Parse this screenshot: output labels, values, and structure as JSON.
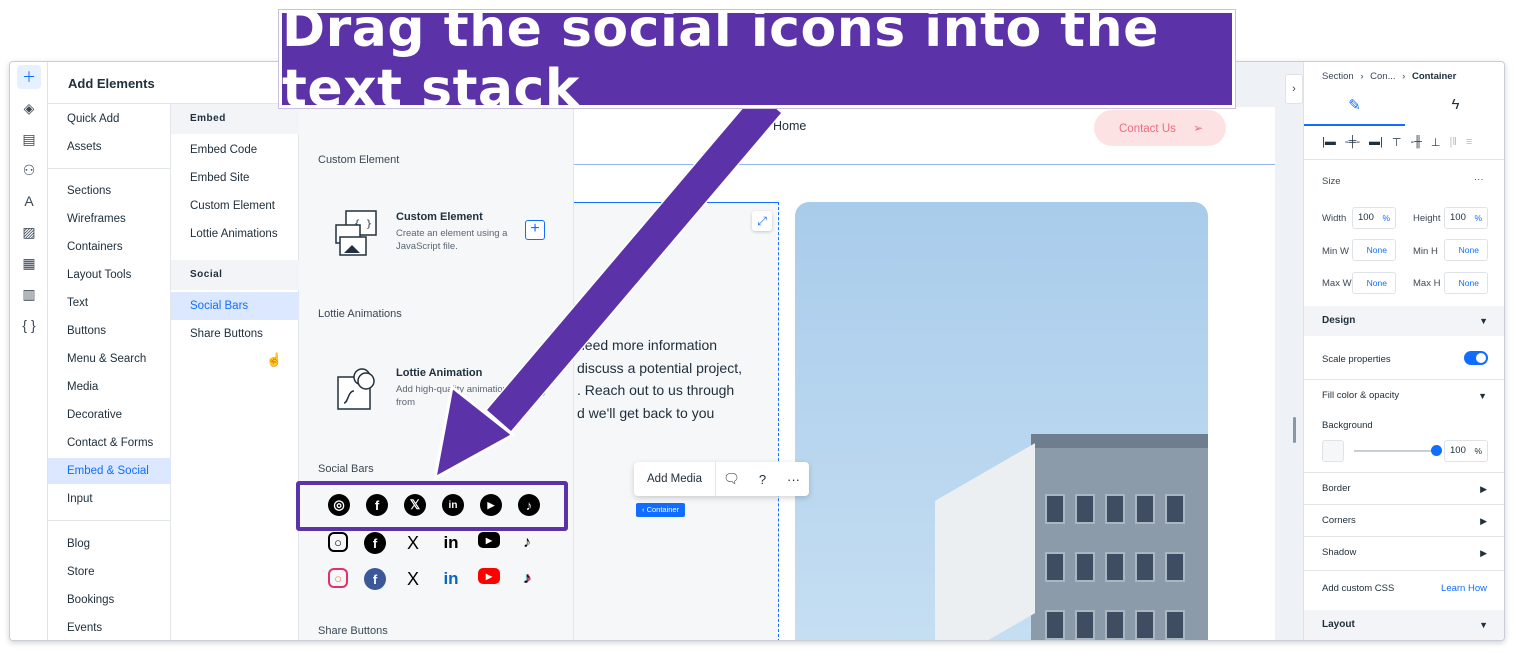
{
  "annotation": {
    "banner": "Drag the social icons into the text stack"
  },
  "colors": {
    "accent": "#116dff",
    "annotation_purple": "#5c32a9",
    "contact_pink": "#fde2e4"
  },
  "rail": {
    "icons": [
      "plus-icon",
      "layers-icon",
      "page-icon",
      "components-icon",
      "text-style-icon",
      "image-icon",
      "apps-icon",
      "table-icon",
      "code-icon"
    ]
  },
  "add_elements": {
    "title": "Add Elements",
    "categories_group1": [
      "Quick Add",
      "Assets"
    ],
    "categories_group2": [
      "Sections",
      "Wireframes",
      "Containers",
      "Layout Tools",
      "Text",
      "Buttons",
      "Menu & Search",
      "Media",
      "Decorative",
      "Contact & Forms",
      "Embed & Social",
      "Input"
    ],
    "categories_group3": [
      "Blog",
      "Store",
      "Bookings",
      "Events"
    ],
    "selected_category": "Embed & Social"
  },
  "sub": {
    "embed_header": "Embed",
    "embed_items": [
      "Embed Code",
      "Embed Site",
      "Custom Element",
      "Lottie Animations"
    ],
    "social_header": "Social",
    "social_items": [
      "Social Bars",
      "Share Buttons"
    ],
    "selected": "Social Bars"
  },
  "detail": {
    "custom_element_section": "Custom Element",
    "custom_element_card": {
      "title": "Custom Element",
      "desc": "Create an element using a JavaScript file."
    },
    "lottie_section": "Lottie Animations",
    "lottie_card": {
      "title": "Lottie Animation",
      "desc": "Add high-quality animations from"
    },
    "social_section": "Social Bars",
    "social_icons": [
      "instagram",
      "facebook",
      "x",
      "linkedin",
      "youtube",
      "tiktok"
    ],
    "share_section": "Share Buttons"
  },
  "canvas": {
    "nav_home": "Home",
    "contact_button": "Contact Us",
    "para_lines": [
      "need more information",
      "discuss a potential project,",
      ". Reach out to us through",
      "d we'll get back to you"
    ],
    "toolbar": {
      "add_media": "Add Media"
    },
    "container_tag": "‹ Container"
  },
  "inspector": {
    "breadcrumb": {
      "a": "Section",
      "b": "Con...",
      "c": "Container",
      "sep": "›"
    },
    "size_label": "Size",
    "more": "···",
    "width_label": "Width",
    "width_value": "100",
    "width_unit": "%",
    "height_label": "Height",
    "height_value": "100",
    "height_unit": "%",
    "min_w_label": "Min W",
    "min_w_value": "None",
    "min_h_label": "Min H",
    "min_h_value": "None",
    "max_w_label": "Max W",
    "max_w_value": "None",
    "max_h_label": "Max H",
    "max_h_value": "None",
    "design_label": "Design",
    "scale_label": "Scale properties",
    "scale_on": true,
    "fill_label": "Fill color & opacity",
    "background_label": "Background",
    "opacity_value": "100",
    "opacity_unit": "%",
    "border_label": "Border",
    "corners_label": "Corners",
    "shadow_label": "Shadow",
    "custom_css_label": "Add custom CSS",
    "learn_how": "Learn How",
    "layout_label": "Layout"
  }
}
